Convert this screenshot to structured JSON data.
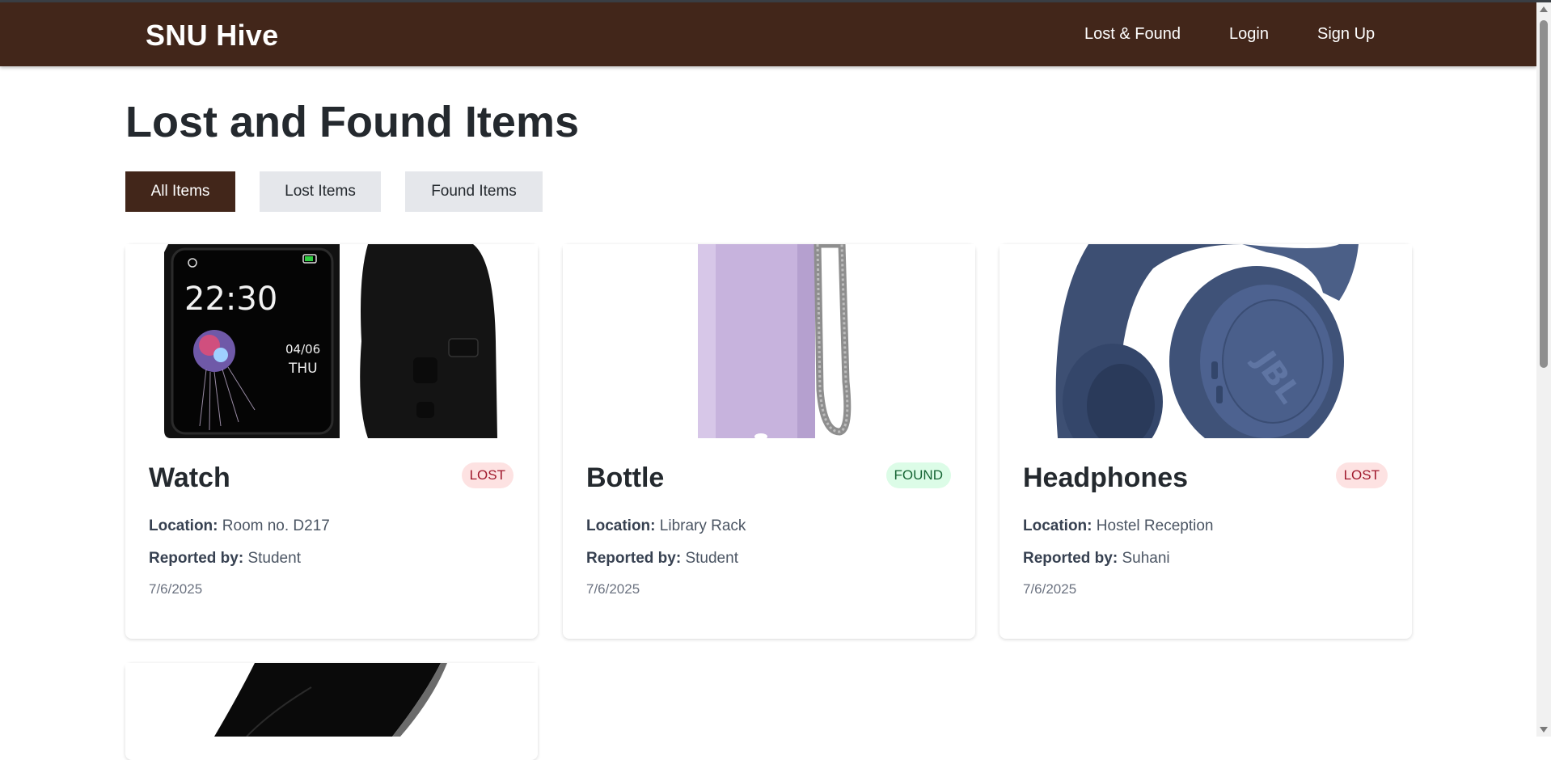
{
  "nav": {
    "brand": "SNU Hive",
    "links": [
      "Lost & Found",
      "Login",
      "Sign Up"
    ]
  },
  "page": {
    "title": "Lost and Found Items",
    "filters": [
      "All Items",
      "Lost Items",
      "Found Items"
    ],
    "active_filter": "All Items"
  },
  "labels": {
    "location": "Location:",
    "reported_by": "Reported by:"
  },
  "items": [
    {
      "name": "Watch",
      "status": "LOST",
      "location": "Room no. D217",
      "reported_by": "Student",
      "date": "7/6/2025"
    },
    {
      "name": "Bottle",
      "status": "FOUND",
      "location": "Library Rack",
      "reported_by": "Student",
      "date": "7/6/2025"
    },
    {
      "name": "Headphones",
      "status": "LOST",
      "location": "Hostel Reception",
      "reported_by": "Suhani",
      "date": "7/6/2025"
    }
  ],
  "colors": {
    "brand": "#42261a",
    "lost_badge_bg": "#fde2e2",
    "lost_badge_text": "#a0192d",
    "found_badge_bg": "#dcfce7",
    "found_badge_text": "#166534"
  },
  "watch_face": {
    "time": "22:30",
    "date": "04/06",
    "day": "THU"
  },
  "headphone_brand": "JBL"
}
